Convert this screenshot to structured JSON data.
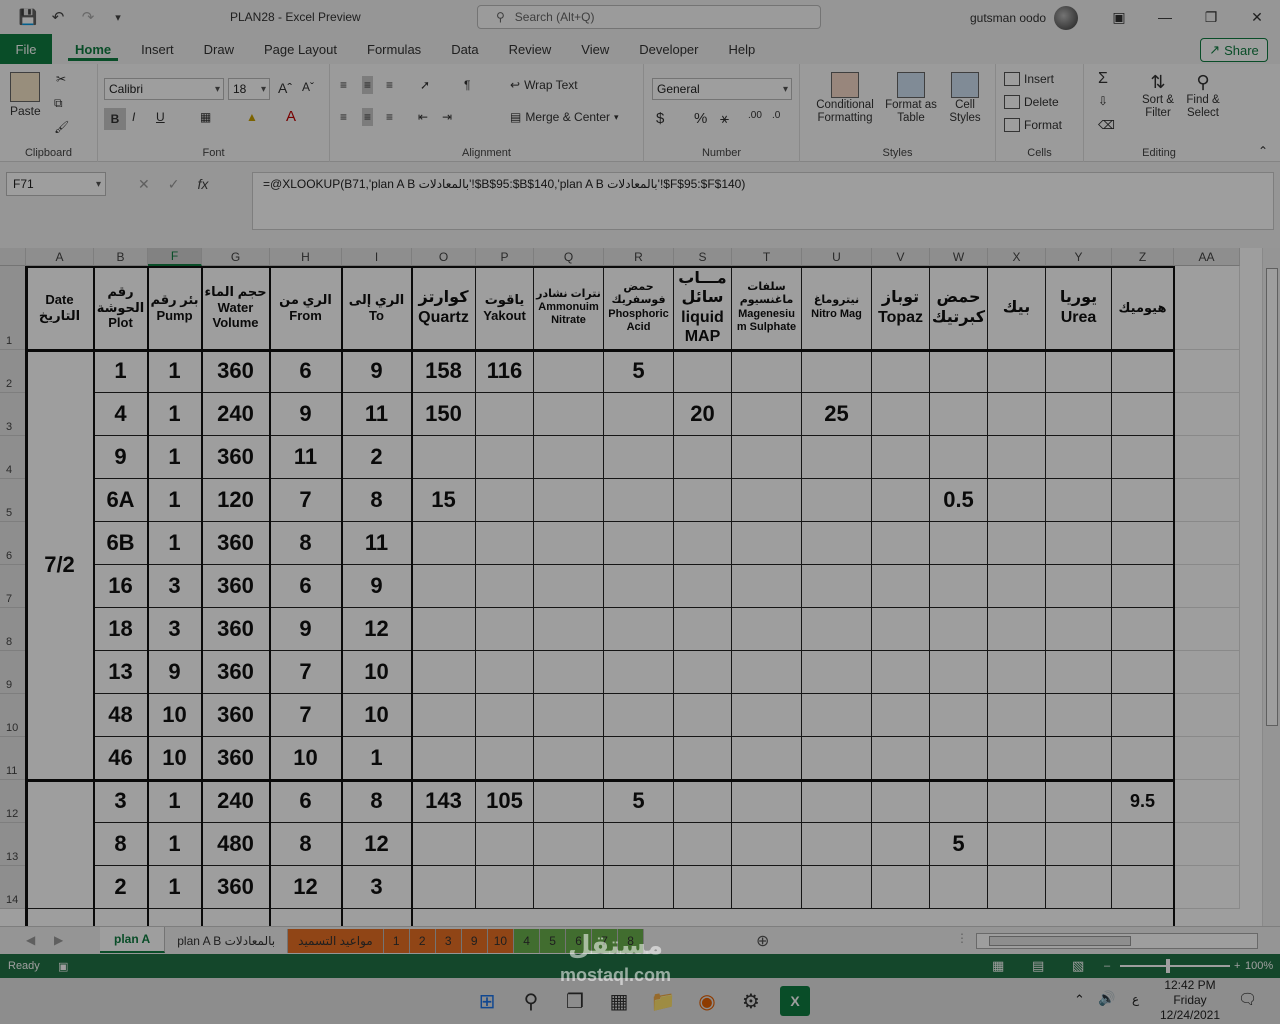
{
  "titlebar": {
    "doc_title": "PLAN28  -  Excel Preview",
    "search_placeholder": "Search (Alt+Q)",
    "user": "gutsman oodo"
  },
  "tabs": [
    "File",
    "Home",
    "Insert",
    "Draw",
    "Page Layout",
    "Formulas",
    "Data",
    "Review",
    "View",
    "Developer",
    "Help"
  ],
  "share_label": "Share",
  "ribbon": {
    "clipboard": {
      "label": "Clipboard",
      "paste": "Paste"
    },
    "font": {
      "label": "Font",
      "name": "Calibri",
      "size": "18"
    },
    "alignment": {
      "label": "Alignment",
      "wrap": "Wrap Text",
      "merge": "Merge & Center"
    },
    "number": {
      "label": "Number",
      "format": "General"
    },
    "styles": {
      "label": "Styles",
      "cond1": "Conditional",
      "cond2": "Formatting",
      "fmt1": "Format as",
      "fmt2": "Table",
      "cell1": "Cell",
      "cell2": "Styles"
    },
    "cells": {
      "label": "Cells",
      "insert": "Insert",
      "delete": "Delete",
      "format": "Format"
    },
    "editing": {
      "label": "Editing",
      "sort1": "Sort &",
      "sort2": "Filter",
      "find1": "Find &",
      "find2": "Select"
    }
  },
  "formula_bar": {
    "name_box": "F71",
    "formula": "=@XLOOKUP(B71,'plan A B بالمعادلات'!$B$95:$B$140,'plan A B بالمعادلات'!$F$95:$F$140)"
  },
  "columns": [
    "A",
    "B",
    "F",
    "G",
    "H",
    "I",
    "O",
    "P",
    "Q",
    "R",
    "S",
    "T",
    "U",
    "V",
    "W",
    "X",
    "Y",
    "Z",
    "AA"
  ],
  "headers": {
    "A": [
      "Date",
      "التاريخ"
    ],
    "B": [
      "رقم",
      "الحوشة",
      "Plot"
    ],
    "F": [
      "بئر رقم",
      "Pump"
    ],
    "G": [
      "حجم الماء",
      "Water",
      "Volume"
    ],
    "H": [
      "الري من",
      "From"
    ],
    "I": [
      "الري إلى",
      "To"
    ],
    "O": [
      "كوارتز",
      "Quartz"
    ],
    "P": [
      "ياقوت",
      "Yakout"
    ],
    "Q": [
      "نترات نشادر",
      "Ammonuim",
      "Nitrate"
    ],
    "R": [
      "حمض فوسفريك",
      "Phosphoric",
      "Acid"
    ],
    "S": [
      "مـــاب",
      "سائل",
      "liquid",
      "MAP"
    ],
    "T": [
      "سلفات ماغنسيوم",
      "Magenesiu",
      "m Sulphate"
    ],
    "U": [
      "نيتروماغ",
      "Nitro Mag"
    ],
    "V": [
      "توباز",
      "Topaz"
    ],
    "W": [
      "حمض",
      "كبرتيك"
    ],
    "X": [
      "بيك"
    ],
    "Y": [
      "يوريا",
      "Urea"
    ],
    "Z": [
      "هيوميك"
    ]
  },
  "rows": [
    {
      "num": "2",
      "B": "1",
      "F": "1",
      "G": "360",
      "H": "6",
      "I": "9",
      "O": "158",
      "P": "116",
      "R": "5"
    },
    {
      "num": "3",
      "B": "4",
      "F": "1",
      "G": "240",
      "H": "9",
      "I": "11",
      "O": "150",
      "S": "20",
      "U": "25"
    },
    {
      "num": "4",
      "B": "9",
      "F": "1",
      "G": "360",
      "H": "11",
      "I": "2"
    },
    {
      "num": "5",
      "B": "6A",
      "F": "1",
      "G": "120",
      "H": "7",
      "I": "8",
      "O": "15",
      "W": "0.5"
    },
    {
      "num": "6",
      "B": "6B",
      "F": "1",
      "G": "360",
      "H": "8",
      "I": "11"
    },
    {
      "num": "7",
      "B": "16",
      "F": "3",
      "G": "360",
      "H": "6",
      "I": "9"
    },
    {
      "num": "8",
      "B": "18",
      "F": "3",
      "G": "360",
      "H": "9",
      "I": "12"
    },
    {
      "num": "9",
      "B": "13",
      "F": "9",
      "G": "360",
      "H": "7",
      "I": "10"
    },
    {
      "num": "10",
      "B": "48",
      "F": "10",
      "G": "360",
      "H": "7",
      "I": "10"
    },
    {
      "num": "11",
      "B": "46",
      "F": "10",
      "G": "360",
      "H": "10",
      "I": "1"
    },
    {
      "num": "12",
      "B": "3",
      "F": "1",
      "G": "240",
      "H": "6",
      "I": "8",
      "O": "143",
      "P": "105",
      "R": "5",
      "Z": "9.5"
    },
    {
      "num": "13",
      "B": "8",
      "F": "1",
      "G": "480",
      "H": "8",
      "I": "12",
      "W": "5"
    },
    {
      "num": "14",
      "B": "2",
      "F": "1",
      "G": "360",
      "H": "12",
      "I": "3"
    }
  ],
  "date_group": "7/2",
  "sheet_tabs": [
    {
      "label": "plan A",
      "color": "#ffffff"
    },
    {
      "label": "plan A B بالمعادلات",
      "color": "#f0f0f0"
    },
    {
      "label": "مواعيد التسميد",
      "color": "#e87025"
    },
    {
      "label": "1",
      "color": "#e87025"
    },
    {
      "label": "2",
      "color": "#e87025"
    },
    {
      "label": "3",
      "color": "#e87025"
    },
    {
      "label": "9",
      "color": "#e87025"
    },
    {
      "label": "10",
      "color": "#e87025"
    },
    {
      "label": "4",
      "color": "#6ab04c"
    },
    {
      "label": "5",
      "color": "#6ab04c"
    },
    {
      "label": "6",
      "color": "#6ab04c"
    },
    {
      "label": "7",
      "color": "#6ab04c"
    },
    {
      "label": "8",
      "color": "#6ab04c"
    }
  ],
  "status": {
    "ready": "Ready",
    "zoom": "100%"
  },
  "taskbar": {
    "time": "12:42 PM",
    "day": "Friday",
    "date": "12/24/2021",
    "lang": "ع"
  },
  "watermark": {
    "line1": "مستقل",
    "line2": "mostaql.com"
  }
}
